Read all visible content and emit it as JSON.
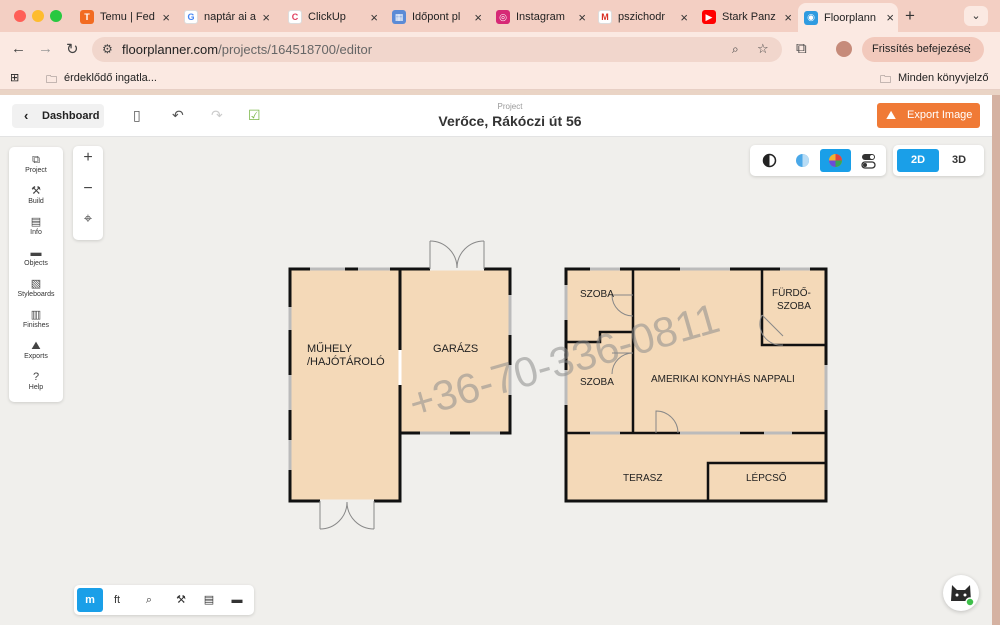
{
  "browser": {
    "tabs": [
      {
        "title": "Temu | Fed",
        "icon": "temu-icon",
        "color": "#f26b21",
        "glyph": "T"
      },
      {
        "title": "naptár ai a",
        "icon": "google-icon",
        "color": "#4285f4",
        "glyph": "G"
      },
      {
        "title": "ClickUp",
        "icon": "clickup-icon",
        "color": "#e0405f",
        "glyph": "C"
      },
      {
        "title": "Időpont pl",
        "icon": "calendar-icon",
        "color": "#5b8bd6",
        "glyph": "▦"
      },
      {
        "title": "Instagram",
        "icon": "instagram-icon",
        "color": "#d62976",
        "glyph": "◎"
      },
      {
        "title": "pszichodr",
        "icon": "gmail-icon",
        "color": "#d93025",
        "glyph": "M"
      },
      {
        "title": "Stark Panz",
        "icon": "youtube-icon",
        "color": "#ff0000",
        "glyph": "▶"
      },
      {
        "title": "Floorplann",
        "icon": "floorplanner-icon",
        "color": "#2f9be0",
        "glyph": "◉"
      }
    ],
    "url_host": "floorplanner.com",
    "url_path": "/projects/164518700/editor",
    "update_label": "Frissítés befejezése",
    "bookmark_folder": "érdeklődő ingatla...",
    "all_bookmarks": "Minden könyvjelző"
  },
  "app": {
    "dashboard_label": "Dashboard",
    "project_label": "Project",
    "project_title": "Verőce, Rákóczi út 56",
    "export_label": "Export Image",
    "accent": "#1a9fe8",
    "export_color": "#f07a36",
    "sidebar": [
      {
        "label": "Project",
        "icon": "project-icon",
        "glyph": "⧉"
      },
      {
        "label": "Build",
        "icon": "build-icon",
        "glyph": "⚒"
      },
      {
        "label": "Info",
        "icon": "info-icon",
        "glyph": "▤"
      },
      {
        "label": "Objects",
        "icon": "objects-icon",
        "glyph": "▬"
      },
      {
        "label": "Styleboards",
        "icon": "styleboards-icon",
        "glyph": "▧"
      },
      {
        "label": "Finishes",
        "icon": "finishes-icon",
        "glyph": "▥"
      },
      {
        "label": "Exports",
        "icon": "exports-icon",
        "glyph": "⛰"
      },
      {
        "label": "Help",
        "icon": "help-icon",
        "glyph": "?"
      }
    ],
    "dim_2d": "2D",
    "dim_3d": "3D",
    "unit_m": "m",
    "unit_ft": "ft"
  },
  "floorplan": {
    "rooms": {
      "muhely_1": "MŰHELY",
      "muhely_2": "/HAJÓTÁROLÓ",
      "garazs": "GARÁZS",
      "szoba_top": "SZOBA",
      "furdo_1": "FÜRDŐ-",
      "furdo_2": "SZOBA",
      "szoba_mid": "SZOBA",
      "nappali": "AMERIKAI KONYHÁS NAPPALI",
      "terasz": "TERASZ",
      "lepcso": "LÉPCSŐ"
    },
    "watermark": "+36-70-336-0811",
    "floor_color": "#f4d9b8"
  }
}
